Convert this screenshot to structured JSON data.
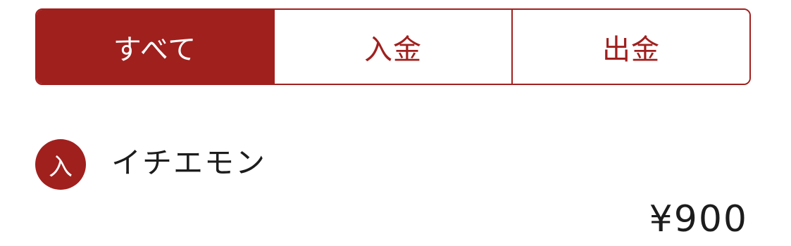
{
  "filter_tabs": [
    {
      "label": "すべて",
      "active": true
    },
    {
      "label": "入金",
      "active": false
    },
    {
      "label": "出金",
      "active": false
    }
  ],
  "transactions": [
    {
      "badge": "入",
      "name": "イチエモン",
      "amount": "¥900"
    }
  ],
  "colors": {
    "accent": "#a0201e",
    "text": "#1c1c1c",
    "background": "#ffffff"
  }
}
